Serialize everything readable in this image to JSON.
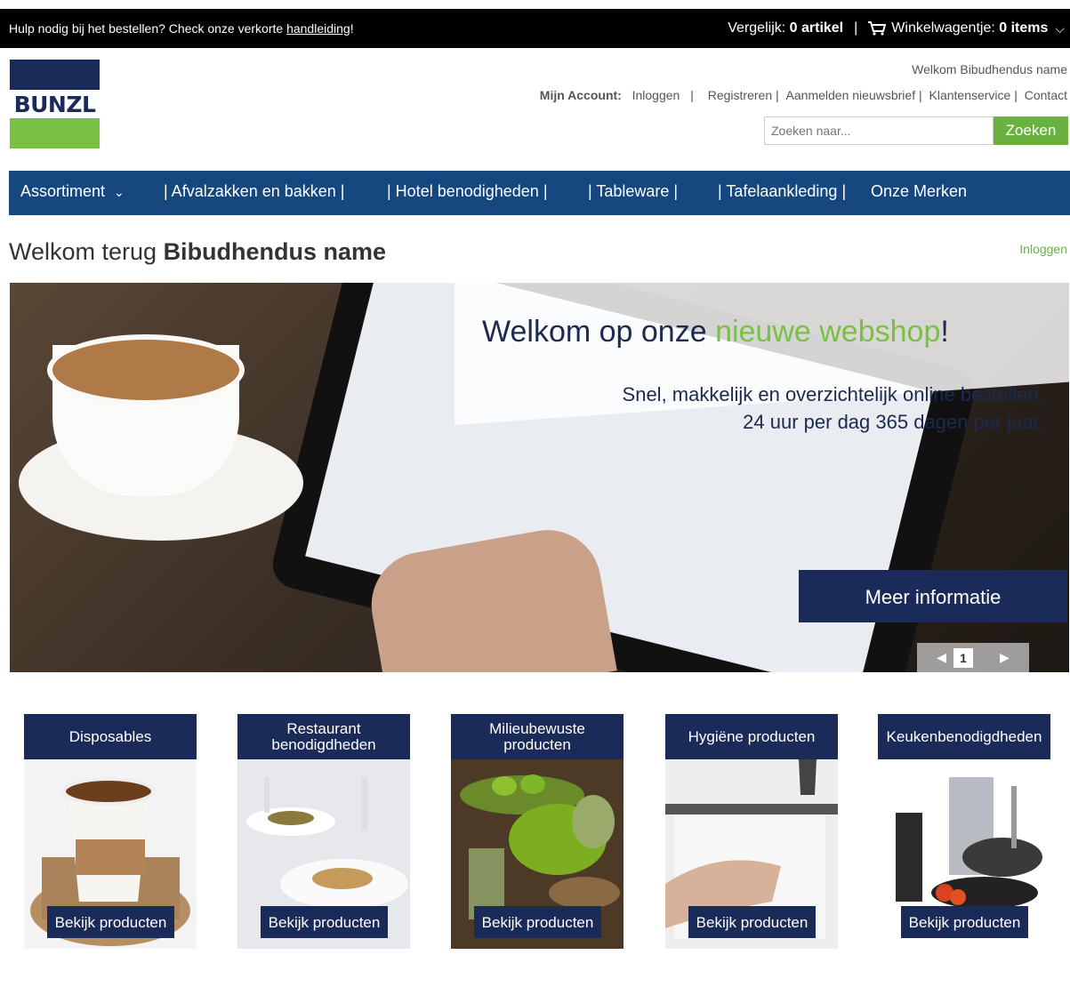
{
  "topbar": {
    "help_text": "Hulp nodig bij het bestellen? Check onze verkorte ",
    "help_link": "handleiding",
    "help_end": "!",
    "compare_label": "Vergelijk:",
    "compare_value": "0 artikel",
    "separator": "|",
    "cart_label": "Winkelwagentje:",
    "cart_value": "0 items"
  },
  "header": {
    "logo_text": "BUNZL",
    "welcome": "Welkom Bibudhendus name",
    "account_label": "Mijn Account:",
    "links": [
      "Inloggen",
      "|",
      "Registreren |",
      "Aanmelden nieuwsbrief |",
      "Klantenservice |",
      "Contact"
    ],
    "search_placeholder": "Zoeken naar...",
    "search_button": "Zoeken"
  },
  "nav": {
    "items": [
      "Assortiment",
      "| Afvalzakken en bakken |",
      "| Hotel benodigheden |",
      "| Tableware |",
      "| Tafelaankleding |",
      "Onze Merken"
    ]
  },
  "greeting": {
    "prefix": "Welkom terug ",
    "name": "Bibudhendus name",
    "login": "Inloggen"
  },
  "hero": {
    "title_a": "Welkom op onze ",
    "title_green": "nieuwe webshop",
    "title_end": "!",
    "line1": "Snel, makkelijk en overzichtelijk online bestellen.",
    "line2": "24 uur per dag 365 dagen per jaar.",
    "more": "Meer informatie",
    "page": "1"
  },
  "categories": [
    {
      "title": "Disposables",
      "button": "Bekijk producten"
    },
    {
      "title": "Restaurant benodigdheden",
      "button": "Bekijk producten"
    },
    {
      "title": "Milieubewuste producten",
      "button": "Bekijk producten"
    },
    {
      "title": "Hygiëne producten",
      "button": "Bekijk producten"
    },
    {
      "title": "Keukenbenodigdheden",
      "button": "Bekijk producten"
    }
  ],
  "colors": {
    "navy": "#1a2b59",
    "nav_blue": "#16487f",
    "green": "#7ac143"
  }
}
